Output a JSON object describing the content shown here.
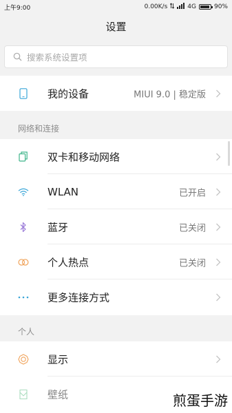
{
  "status": {
    "time": "上午9:00",
    "speed": "0.00K/s",
    "network": "4G",
    "battery": "90%",
    "battery_level": 0.9
  },
  "header": {
    "title": "设置"
  },
  "search": {
    "placeholder": "搜索系统设置项"
  },
  "device": {
    "label": "我的设备",
    "value": "MIUI 9.0 | 稳定版"
  },
  "sections": {
    "network": {
      "title": "网络和连接"
    },
    "personal": {
      "title": "个人"
    }
  },
  "network_items": [
    {
      "label": "双卡和移动网络",
      "value": ""
    },
    {
      "label": "WLAN",
      "value": "已开启"
    },
    {
      "label": "蓝牙",
      "value": "已关闭"
    },
    {
      "label": "个人热点",
      "value": "已关闭"
    },
    {
      "label": "更多连接方式",
      "value": ""
    }
  ],
  "personal_items": [
    {
      "label": "显示"
    },
    {
      "label": "壁纸"
    }
  ],
  "watermark": "煎蛋手游",
  "colors": {
    "sim": "#3fb58a",
    "wifi": "#3aa6d8",
    "bluetooth": "#9b7bd8",
    "hotspot": "#f0a35a",
    "more": "#3aa6d8",
    "display": "#f0a35a",
    "wallpaper": "#66c08a"
  }
}
